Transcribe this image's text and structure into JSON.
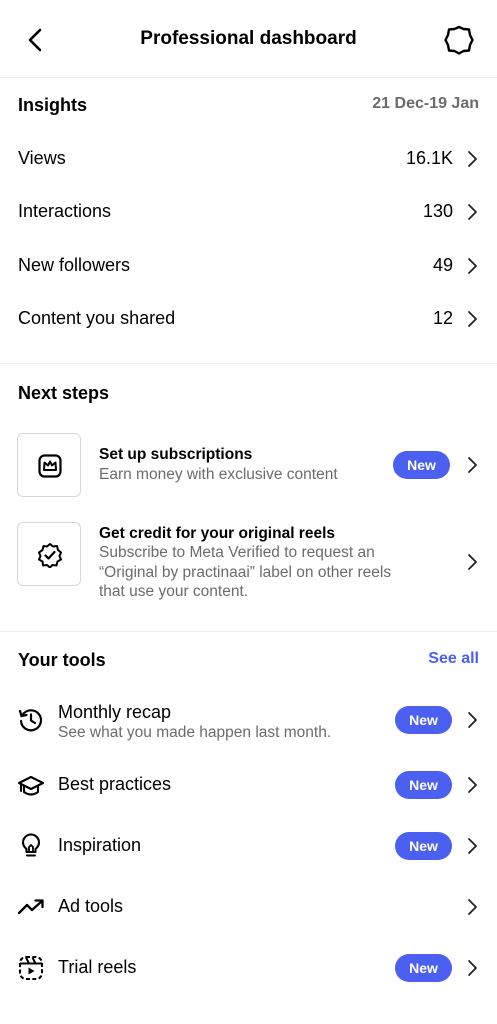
{
  "header": {
    "title": "Professional dashboard",
    "back_icon": "chevron-left-icon",
    "settings_icon": "gear-icon"
  },
  "insights": {
    "title": "Insights",
    "date_range": "21 Dec-19 Jan",
    "metrics": [
      {
        "label": "Views",
        "value": "16.1K"
      },
      {
        "label": "Interactions",
        "value": "130"
      },
      {
        "label": "New followers",
        "value": "49"
      },
      {
        "label": "Content you shared",
        "value": "12"
      }
    ]
  },
  "next_steps": {
    "title": "Next steps",
    "items": [
      {
        "title": "Set up subscriptions",
        "description": "Earn money with exclusive content",
        "badge": "New",
        "icon": "subscription-crown-icon"
      },
      {
        "title": "Get credit for your original reels",
        "description_lines": [
          "Subscribe to Meta Verified to request an",
          "“Original by practinaai” label on other reels",
          "that use your content."
        ],
        "icon": "verified-badge-icon"
      }
    ]
  },
  "tools": {
    "title": "Your tools",
    "see_all": "See all",
    "items": [
      {
        "label": "Monthly recap",
        "subtitle": "See what you made happen last month.",
        "badge": "New",
        "icon": "history-icon"
      },
      {
        "label": "Best practices",
        "badge": "New",
        "icon": "graduation-cap-icon"
      },
      {
        "label": "Inspiration",
        "badge": "New",
        "icon": "lightbulb-icon"
      },
      {
        "label": "Ad tools",
        "icon": "trending-up-icon"
      },
      {
        "label": "Trial reels",
        "badge": "New",
        "icon": "reel-play-icon"
      }
    ]
  },
  "colors": {
    "accent": "#4b5ff0",
    "secondary_text": "#6b6b6b",
    "divider": "#ececec"
  }
}
